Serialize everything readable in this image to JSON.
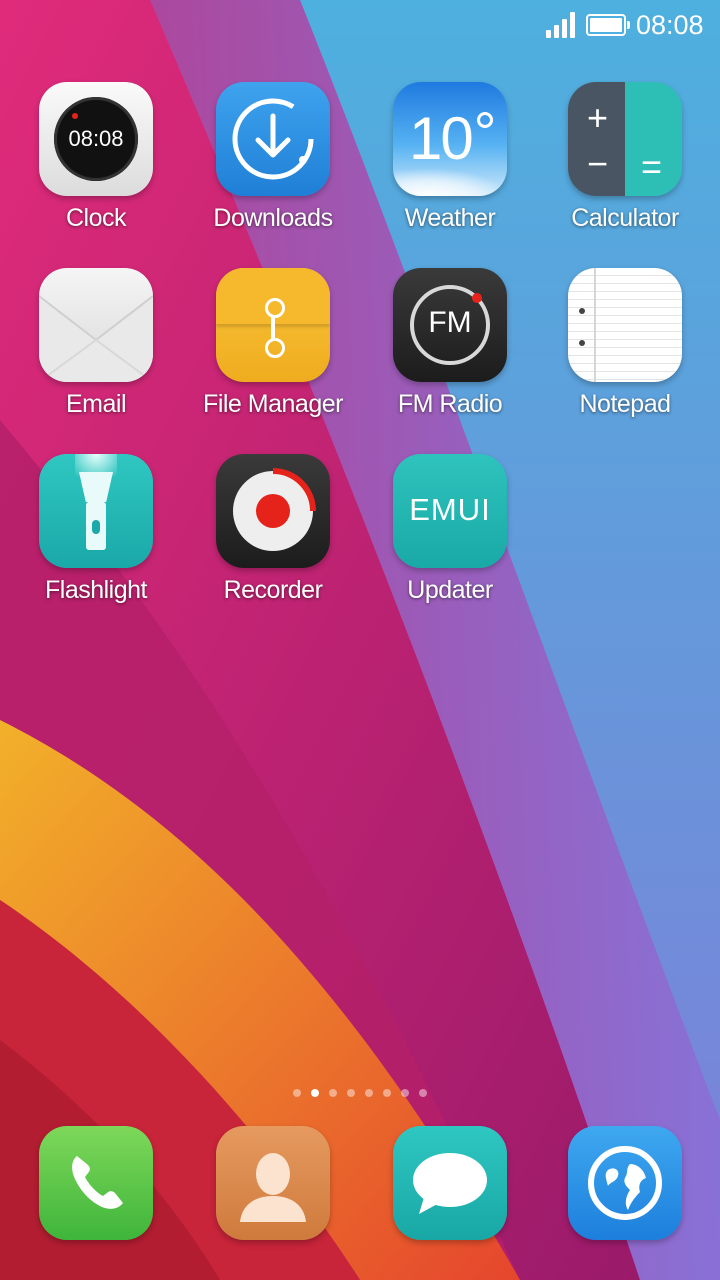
{
  "statusbar": {
    "time": "08:08",
    "signal_icon": "signal-icon",
    "battery_icon": "battery-icon"
  },
  "apps": [
    {
      "label": "Clock",
      "icon": "clock-icon",
      "clock_time": "08:08"
    },
    {
      "label": "Downloads",
      "icon": "download-icon"
    },
    {
      "label": "Weather",
      "icon": "weather-icon",
      "temp": "10"
    },
    {
      "label": "Calculator",
      "icon": "calculator-icon"
    },
    {
      "label": "Email",
      "icon": "email-icon"
    },
    {
      "label": "File Manager",
      "icon": "folder-icon"
    },
    {
      "label": "FM Radio",
      "icon": "radio-icon",
      "icon_text": "FM"
    },
    {
      "label": "Notepad",
      "icon": "notepad-icon"
    },
    {
      "label": "Flashlight",
      "icon": "flashlight-icon"
    },
    {
      "label": "Recorder",
      "icon": "record-icon"
    },
    {
      "label": "Updater",
      "icon": "emui-icon",
      "icon_text": "EMUI"
    }
  ],
  "page_indicator": {
    "count": 8,
    "active_index": 1
  },
  "dock": [
    {
      "name": "phone",
      "icon": "phone-icon"
    },
    {
      "name": "contacts",
      "icon": "contact-icon"
    },
    {
      "name": "messages",
      "icon": "message-icon"
    },
    {
      "name": "browser",
      "icon": "globe-icon"
    }
  ]
}
